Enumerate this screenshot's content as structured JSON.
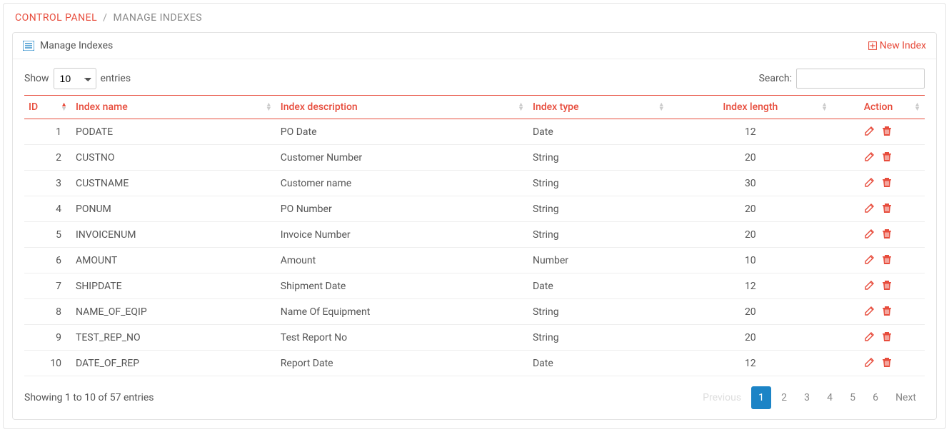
{
  "breadcrumb": {
    "control_panel": "CONTROL PANEL",
    "sep": "/",
    "page": "MANAGE INDEXES"
  },
  "panel": {
    "title": "Manage Indexes",
    "new_index": "New Index"
  },
  "controls": {
    "show": "Show",
    "entries": "entries",
    "length_value": "10",
    "search_label": "Search:"
  },
  "columns": {
    "id": "ID",
    "name": "Index name",
    "desc": "Index description",
    "type": "Index type",
    "len": "Index length",
    "action": "Action"
  },
  "rows": [
    {
      "id": "1",
      "name": "PODATE",
      "desc": "PO Date",
      "type": "Date",
      "len": "12"
    },
    {
      "id": "2",
      "name": "CUSTNO",
      "desc": "Customer Number",
      "type": "String",
      "len": "20"
    },
    {
      "id": "3",
      "name": "CUSTNAME",
      "desc": "Customer name",
      "type": "String",
      "len": "30"
    },
    {
      "id": "4",
      "name": "PONUM",
      "desc": "PO Number",
      "type": "String",
      "len": "20"
    },
    {
      "id": "5",
      "name": "INVOICENUM",
      "desc": "Invoice Number",
      "type": "String",
      "len": "20"
    },
    {
      "id": "6",
      "name": "AMOUNT",
      "desc": "Amount",
      "type": "Number",
      "len": "10"
    },
    {
      "id": "7",
      "name": "SHIPDATE",
      "desc": "Shipment Date",
      "type": "Date",
      "len": "12"
    },
    {
      "id": "8",
      "name": "NAME_OF_EQIP",
      "desc": "Name Of Equipment",
      "type": "String",
      "len": "20"
    },
    {
      "id": "9",
      "name": "TEST_REP_NO",
      "desc": "Test Report No",
      "type": "String",
      "len": "20"
    },
    {
      "id": "10",
      "name": "DATE_OF_REP",
      "desc": "Report Date",
      "type": "Date",
      "len": "12"
    }
  ],
  "footer": {
    "info": "Showing 1 to 10 of 57 entries",
    "prev": "Previous",
    "next": "Next",
    "pages": [
      "1",
      "2",
      "3",
      "4",
      "5",
      "6"
    ]
  }
}
